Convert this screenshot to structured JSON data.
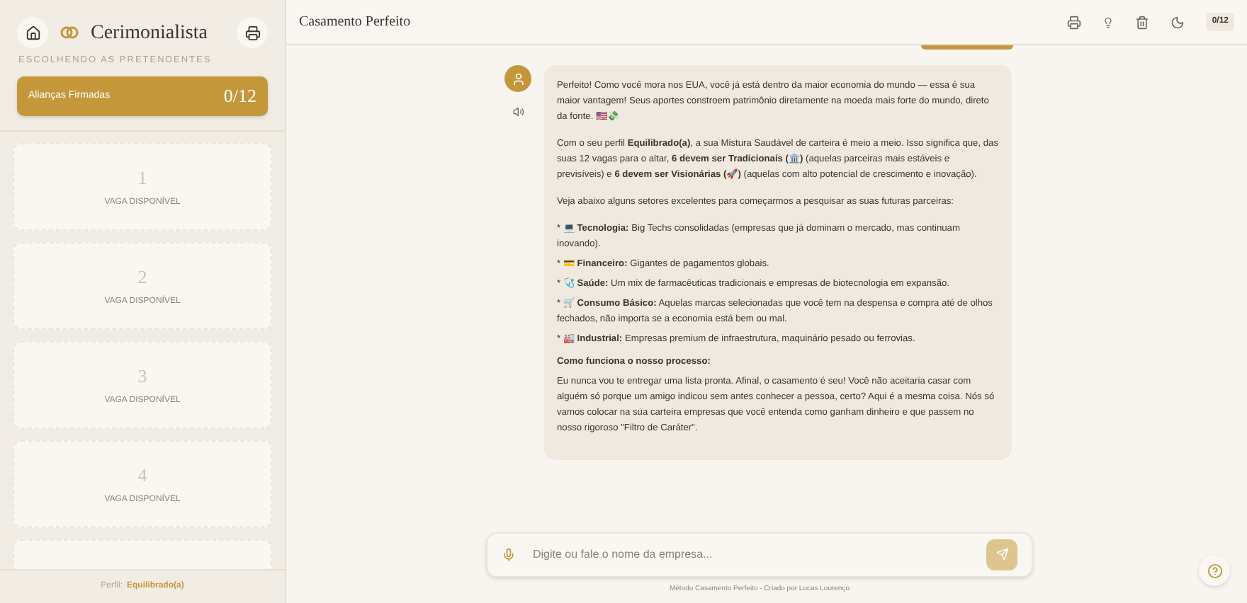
{
  "sidebar": {
    "title": "Cerimonialista",
    "subtitle": "ESCOLHENDO AS PRETENDENTES",
    "progress": {
      "label": "Alianças Firmadas",
      "count": "0/12"
    },
    "slots": [
      {
        "number": "1",
        "label": "VAGA DISPONÍVEL"
      },
      {
        "number": "2",
        "label": "VAGA DISPONÍVEL"
      },
      {
        "number": "3",
        "label": "VAGA DISPONÍVEL"
      },
      {
        "number": "4",
        "label": "VAGA DISPONÍVEL"
      }
    ],
    "footer": {
      "label": "Perfil:",
      "value": "Equilibrado(a)"
    }
  },
  "header": {
    "title": "Casamento Perfeito",
    "badge": "0/12"
  },
  "message": {
    "blocks": [
      {
        "kind": "paragraph",
        "text": "Perfeito! Como você mora nos EUA, você já está dentro da maior economia do mundo — essa é sua maior vantagem! Seus aportes constroem patrimônio diretamente na moeda mais forte do mundo, direto da fonte. 🇺🇸💸"
      },
      {
        "kind": "paragraph",
        "text": "Com o seu perfil **Equilibrado(a)**, a sua Mistura Saudável de carteira é meio a meio. Isso significa que, das suas 12 vagas para o altar, **6 devem ser Tradicionais (🏛️)** (aquelas parceiras mais estáveis e previsíveis) e **6 devem ser Visionárias (🚀)** (aquelas com alto potencial de crescimento e inovação)."
      },
      {
        "kind": "paragraph",
        "text": "Veja abaixo alguns setores excelentes para começarmos a pesquisar as suas futuras parceiras:"
      },
      {
        "kind": "bullet",
        "text": "* 💻 **Tecnologia:** Big Techs consolidadas (empresas que já dominam o mercado, mas continuam inovando)."
      },
      {
        "kind": "bullet",
        "text": "* 💳 **Financeiro:** Gigantes de pagamentos globais."
      },
      {
        "kind": "bullet",
        "text": "* 🩺 **Saúde:** Um mix de farmacêuticas tradicionais e empresas de biotecnologia em expansão."
      },
      {
        "kind": "bullet",
        "text": "* 🛒 **Consumo Básico:** Aquelas marcas selecionadas que você tem na despensa e compra até de olhos fechados, não importa se a economia está bem ou mal."
      },
      {
        "kind": "bullet",
        "text": "* 🏭 **Industrial:** Empresas premium de infraestrutura, maquinário pesado ou ferrovias."
      },
      {
        "kind": "heading",
        "text": "Como funciona o nosso processo:"
      },
      {
        "kind": "paragraph",
        "text": "Eu nunca vou te entregar uma lista pronta. Afinal, o casamento é seu! Você não aceitaria casar com alguém só porque um amigo indicou sem antes conhecer a pessoa, certo? Aqui é a mesma coisa. Nós só vamos colocar na sua carteira empresas que você entenda como ganham dinheiro e que passem no nosso rigoroso \"Filtro de Caráter\"."
      }
    ]
  },
  "input": {
    "placeholder": "Digite ou fale o nome da empresa..."
  },
  "credit": "Método Casamento Perfeito - Criado por Lucas Lourenço"
}
